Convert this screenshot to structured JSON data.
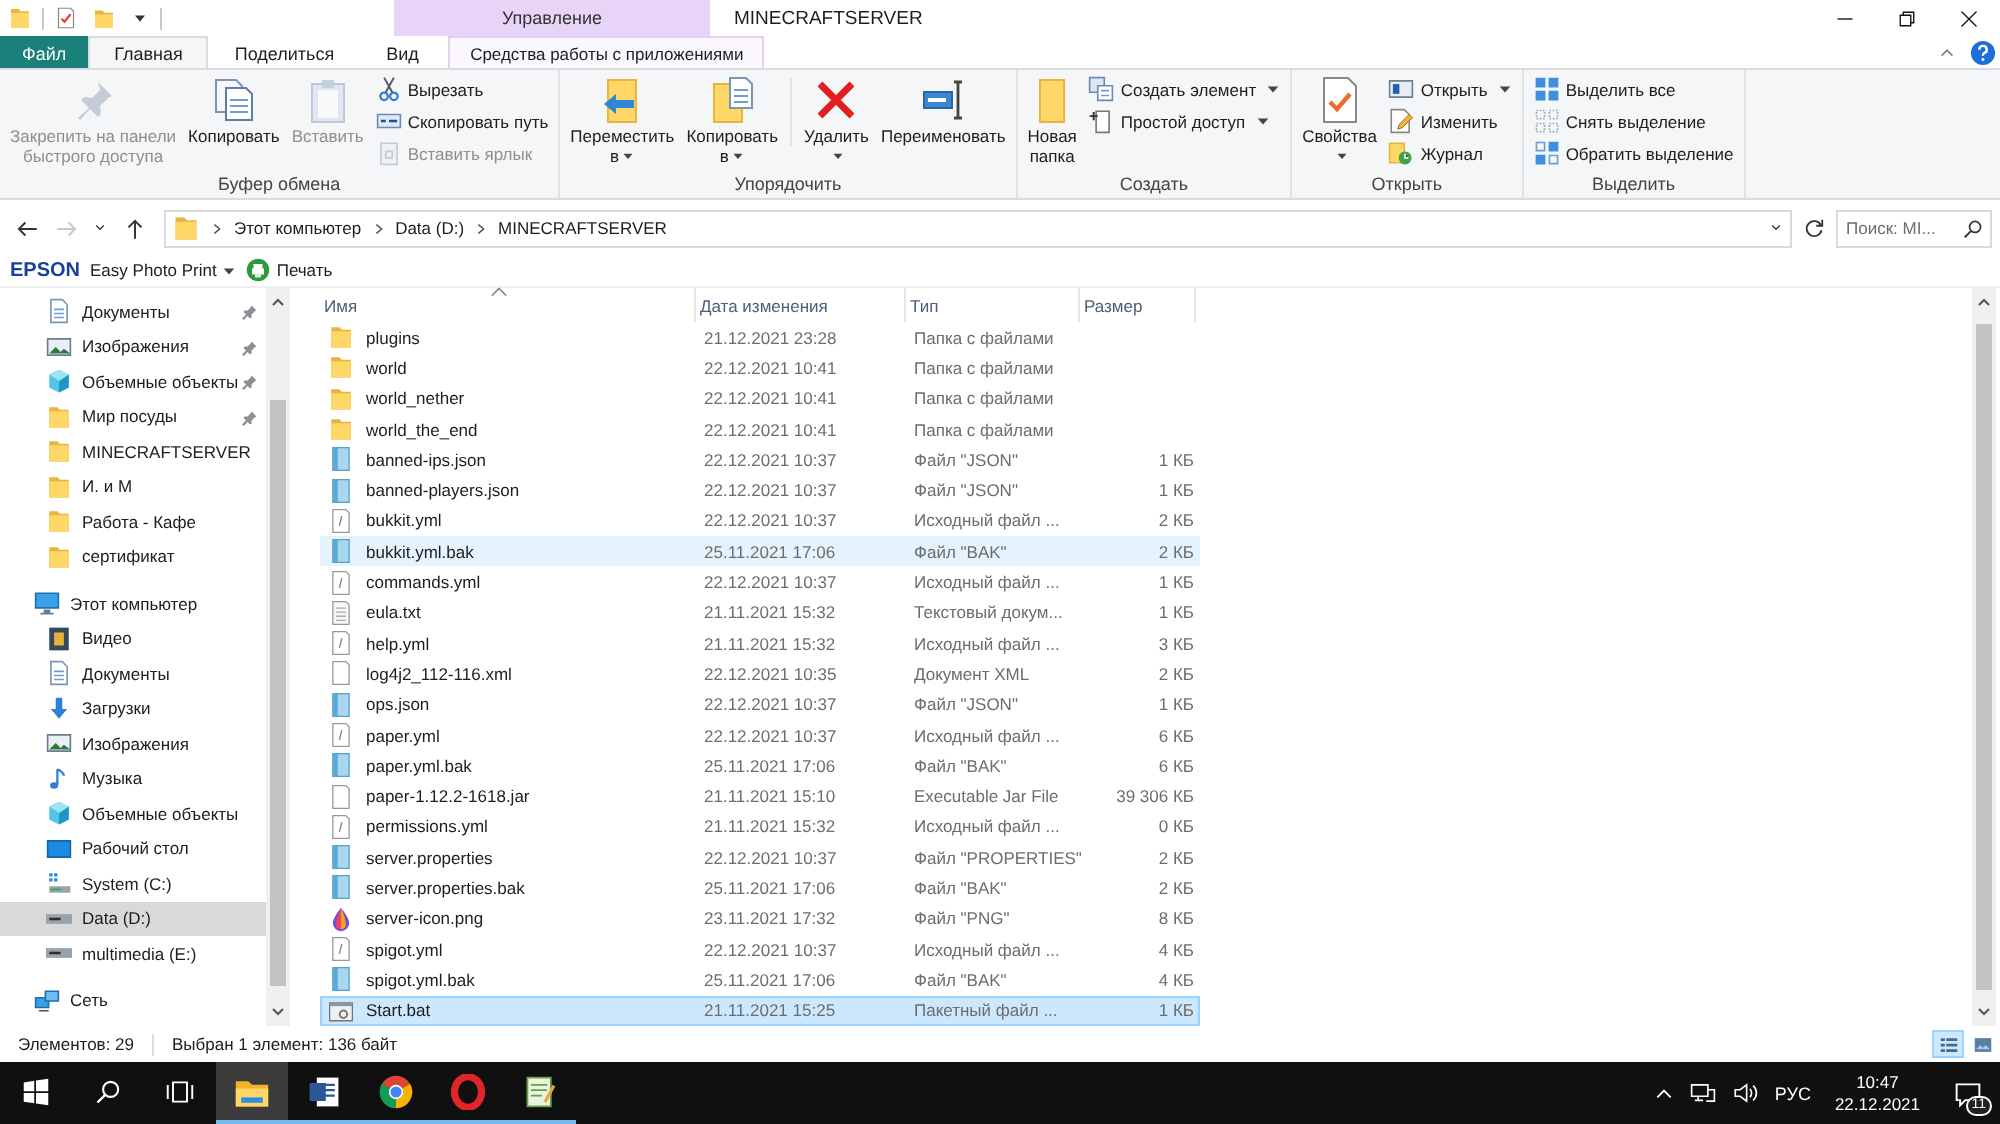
{
  "quick_access_toolbar": [
    {
      "kind": "folder"
    },
    {
      "kind": "properties"
    },
    {
      "kind": "new-folder"
    },
    {
      "kind": "customize"
    }
  ],
  "context_header": "Управление",
  "window": {
    "title": "MINECRAFTSERVER"
  },
  "tabs": [
    {
      "label": "Файл",
      "kind": "file",
      "selected": false
    },
    {
      "label": "Главная",
      "kind": "normal",
      "selected": true
    },
    {
      "label": "Поделиться",
      "kind": "normal",
      "selected": false
    },
    {
      "label": "Вид",
      "kind": "normal",
      "selected": false
    },
    {
      "label": "Средства работы с приложениями",
      "kind": "contextual",
      "selected": false
    }
  ],
  "ribbon": {
    "groups": [
      {
        "label": "Буфер обмена",
        "items": [
          {
            "kind": "large",
            "label": [
              "Закрепить на панели",
              "быстрого доступа"
            ],
            "disabled": true,
            "dropdown": false
          },
          {
            "kind": "large",
            "label": [
              "Копировать"
            ],
            "disabled": false,
            "dropdown": false
          },
          {
            "kind": "large",
            "label": [
              "Вставить"
            ],
            "disabled": true,
            "dropdown": false
          },
          {
            "kind": "stack",
            "items": [
              {
                "label": "Вырезать",
                "disabled": false,
                "dropdown": false
              },
              {
                "label": "Скопировать путь",
                "disabled": false,
                "dropdown": false
              },
              {
                "label": "Вставить ярлык",
                "disabled": true,
                "dropdown": false
              }
            ]
          }
        ]
      },
      {
        "label": "Упорядочить",
        "items": [
          {
            "kind": "large",
            "label": [
              "Переместить",
              "в"
            ],
            "disabled": false,
            "dropdown": true
          },
          {
            "kind": "large",
            "label": [
              "Копировать",
              "в"
            ],
            "disabled": false,
            "dropdown": true
          },
          {
            "kind": "separator"
          },
          {
            "kind": "large",
            "label": [
              "Удалить"
            ],
            "disabled": false,
            "dropdown": true
          },
          {
            "kind": "large",
            "label": [
              "Переименовать"
            ],
            "disabled": false,
            "dropdown": false
          }
        ]
      },
      {
        "label": "Создать",
        "items": [
          {
            "kind": "large",
            "label": [
              "Новая",
              "папка"
            ],
            "disabled": false,
            "dropdown": false
          },
          {
            "kind": "stack",
            "items": [
              {
                "label": "Создать элемент",
                "disabled": false,
                "dropdown": true
              },
              {
                "label": "Простой доступ",
                "disabled": false,
                "dropdown": true
              }
            ]
          }
        ]
      },
      {
        "label": "Открыть",
        "items": [
          {
            "kind": "large",
            "label": [
              "Свойства"
            ],
            "disabled": false,
            "dropdown": true
          },
          {
            "kind": "stack",
            "items": [
              {
                "label": "Открыть",
                "disabled": false,
                "dropdown": true
              },
              {
                "label": "Изменить",
                "disabled": false,
                "dropdown": false
              },
              {
                "label": "Журнал",
                "disabled": false,
                "dropdown": false
              }
            ]
          }
        ]
      },
      {
        "label": "Выделить",
        "items": [
          {
            "kind": "stack",
            "items": [
              {
                "label": "Выделить все",
                "disabled": false,
                "dropdown": false
              },
              {
                "label": "Снять выделение",
                "disabled": false,
                "dropdown": false
              },
              {
                "label": "Обратить выделение",
                "disabled": false,
                "dropdown": false
              }
            ]
          }
        ]
      }
    ]
  },
  "nav_buttons": [
    {
      "kind": "back",
      "disabled": false
    },
    {
      "kind": "forward",
      "disabled": true
    },
    {
      "kind": "recent",
      "disabled": false
    },
    {
      "kind": "up",
      "disabled": false
    }
  ],
  "breadcrumbs": [
    "Этот компьютер",
    "Data (D:)",
    "MINECRAFTSERVER"
  ],
  "search": {
    "placeholder": "Поиск: MI..."
  },
  "epson_toolbar": {
    "logo": "EPSON",
    "menu": "Easy Photo Print",
    "action": "Печать"
  },
  "quick_access_items": [
    {
      "label": "Документы",
      "kind": "documents",
      "pinned": true,
      "selected": false
    },
    {
      "label": "Изображения",
      "kind": "pictures",
      "pinned": true,
      "selected": false
    },
    {
      "label": "Объемные объекты",
      "kind": "objects",
      "pinned": true,
      "selected": false
    },
    {
      "label": "Мир посуды",
      "kind": "folder",
      "pinned": true,
      "selected": false
    },
    {
      "label": "MINECRAFTSERVER",
      "kind": "folder",
      "pinned": false,
      "selected": false
    },
    {
      "label": "И. и М",
      "kind": "folder",
      "pinned": false,
      "selected": false
    },
    {
      "label": "Работа - Кафе",
      "kind": "folder",
      "pinned": false,
      "selected": false
    },
    {
      "label": "сертификат",
      "kind": "folder",
      "pinned": false,
      "selected": false
    }
  ],
  "tree": [
    {
      "label": "Этот компьютер",
      "kind": "computer",
      "selected": false,
      "children": [
        {
          "label": "Видео",
          "kind": "video",
          "selected": false
        },
        {
          "label": "Документы",
          "kind": "documents",
          "selected": false
        },
        {
          "label": "Загрузки",
          "kind": "downloads",
          "selected": false
        },
        {
          "label": "Изображения",
          "kind": "pictures",
          "selected": false
        },
        {
          "label": "Музыка",
          "kind": "music",
          "selected": false
        },
        {
          "label": "Объемные объекты",
          "kind": "objects",
          "selected": false
        },
        {
          "label": "Рабочий стол",
          "kind": "desktop",
          "selected": false
        },
        {
          "label": "System (C:)",
          "kind": "system-drive",
          "selected": false
        },
        {
          "label": "Data (D:)",
          "kind": "drive",
          "selected": true
        },
        {
          "label": "multimedia (E:)",
          "kind": "drive",
          "selected": false
        }
      ]
    },
    {
      "label": "Сеть",
      "kind": "network",
      "selected": false
    }
  ],
  "columns": [
    {
      "label": "Имя",
      "sorted": true
    },
    {
      "label": "Дата изменения",
      "sorted": false
    },
    {
      "label": "Тип",
      "sorted": false
    },
    {
      "label": "Размер",
      "sorted": false
    }
  ],
  "files": [
    {
      "name": "plugins",
      "kind": "folder",
      "date": "21.12.2021 23:28",
      "type": "Папка с файлами",
      "selected": false,
      "hot": false
    },
    {
      "name": "world",
      "kind": "folder",
      "date": "22.12.2021 10:41",
      "type": "Папка с файлами",
      "selected": false,
      "hot": false
    },
    {
      "name": "world_nether",
      "kind": "folder",
      "date": "22.12.2021 10:41",
      "type": "Папка с файлами",
      "selected": false,
      "hot": false
    },
    {
      "name": "world_the_end",
      "kind": "folder",
      "date": "22.12.2021 10:41",
      "type": "Папка с файлами",
      "selected": false,
      "hot": false
    },
    {
      "name": "banned-ips.json",
      "kind": "data",
      "date": "22.12.2021 10:37",
      "type": "Файл \"JSON\"",
      "size": "1 КБ",
      "selected": false,
      "hot": false
    },
    {
      "name": "banned-players.json",
      "kind": "data",
      "date": "22.12.2021 10:37",
      "type": "Файл \"JSON\"",
      "size": "1 КБ",
      "selected": false,
      "hot": false
    },
    {
      "name": "bukkit.yml",
      "kind": "script",
      "date": "22.12.2021 10:37",
      "type": "Исходный файл ...",
      "size": "2 КБ",
      "selected": false,
      "hot": false
    },
    {
      "name": "bukkit.yml.bak",
      "kind": "data",
      "date": "25.11.2021 17:06",
      "type": "Файл \"BAK\"",
      "size": "2 КБ",
      "selected": false,
      "hot": true
    },
    {
      "name": "commands.yml",
      "kind": "script",
      "date": "22.12.2021 10:37",
      "type": "Исходный файл ...",
      "size": "1 КБ",
      "selected": false,
      "hot": false
    },
    {
      "name": "eula.txt",
      "kind": "text",
      "date": "21.11.2021 15:32",
      "type": "Текстовый докум...",
      "size": "1 КБ",
      "selected": false,
      "hot": false
    },
    {
      "name": "help.yml",
      "kind": "script",
      "date": "21.11.2021 15:32",
      "type": "Исходный файл ...",
      "size": "3 КБ",
      "selected": false,
      "hot": false
    },
    {
      "name": "log4j2_112-116.xml",
      "kind": "blank",
      "date": "22.12.2021 10:35",
      "type": "Документ XML",
      "size": "2 КБ",
      "selected": false,
      "hot": false
    },
    {
      "name": "ops.json",
      "kind": "data",
      "date": "22.12.2021 10:37",
      "type": "Файл \"JSON\"",
      "size": "1 КБ",
      "selected": false,
      "hot": false
    },
    {
      "name": "paper.yml",
      "kind": "script",
      "date": "22.12.2021 10:37",
      "type": "Исходный файл ...",
      "size": "6 КБ",
      "selected": false,
      "hot": false
    },
    {
      "name": "paper.yml.bak",
      "kind": "data",
      "date": "25.11.2021 17:06",
      "type": "Файл \"BAK\"",
      "size": "6 КБ",
      "selected": false,
      "hot": false
    },
    {
      "name": "paper-1.12.2-1618.jar",
      "kind": "blank",
      "date": "21.11.2021 15:10",
      "type": "Executable Jar File",
      "size": "39 306 КБ",
      "selected": false,
      "hot": false
    },
    {
      "name": "permissions.yml",
      "kind": "script",
      "date": "21.11.2021 15:32",
      "type": "Исходный файл ...",
      "size": "0 КБ",
      "selected": false,
      "hot": false
    },
    {
      "name": "server.properties",
      "kind": "data",
      "date": "22.12.2021 10:37",
      "type": "Файл \"PROPERTIES\"",
      "size": "2 КБ",
      "selected": false,
      "hot": false
    },
    {
      "name": "server.properties.bak",
      "kind": "data",
      "date": "25.11.2021 17:06",
      "type": "Файл \"BAK\"",
      "size": "2 КБ",
      "selected": false,
      "hot": false
    },
    {
      "name": "server-icon.png",
      "kind": "image",
      "date": "23.11.2021 17:32",
      "type": "Файл \"PNG\"",
      "size": "8 КБ",
      "selected": false,
      "hot": false
    },
    {
      "name": "spigot.yml",
      "kind": "script",
      "date": "22.12.2021 10:37",
      "type": "Исходный файл ...",
      "size": "4 КБ",
      "selected": false,
      "hot": false
    },
    {
      "name": "spigot.yml.bak",
      "kind": "data",
      "date": "25.11.2021 17:06",
      "type": "Файл \"BAK\"",
      "size": "4 КБ",
      "selected": false,
      "hot": false
    },
    {
      "name": "Start.bat",
      "kind": "batch",
      "date": "21.11.2021 15:25",
      "type": "Пакетный файл ...",
      "size": "1 КБ",
      "selected": true,
      "hot": false
    }
  ],
  "status_bar": {
    "item_count": "Элементов: 29",
    "selection": "Выбран 1 элемент: 136 байт",
    "views": [
      {
        "kind": "details",
        "selected": true
      },
      {
        "kind": "large-icons",
        "selected": false
      }
    ]
  },
  "taskbar": {
    "apps": [
      {
        "kind": "explorer",
        "active": true,
        "running": true
      },
      {
        "kind": "word",
        "active": false,
        "running": true
      },
      {
        "kind": "chrome",
        "active": false,
        "running": true
      },
      {
        "kind": "opera",
        "active": false,
        "running": true
      },
      {
        "kind": "notepad",
        "active": false,
        "running": true
      }
    ],
    "language": "РУС",
    "time": "10:47",
    "date": "22.12.2021",
    "notifications": "11"
  }
}
